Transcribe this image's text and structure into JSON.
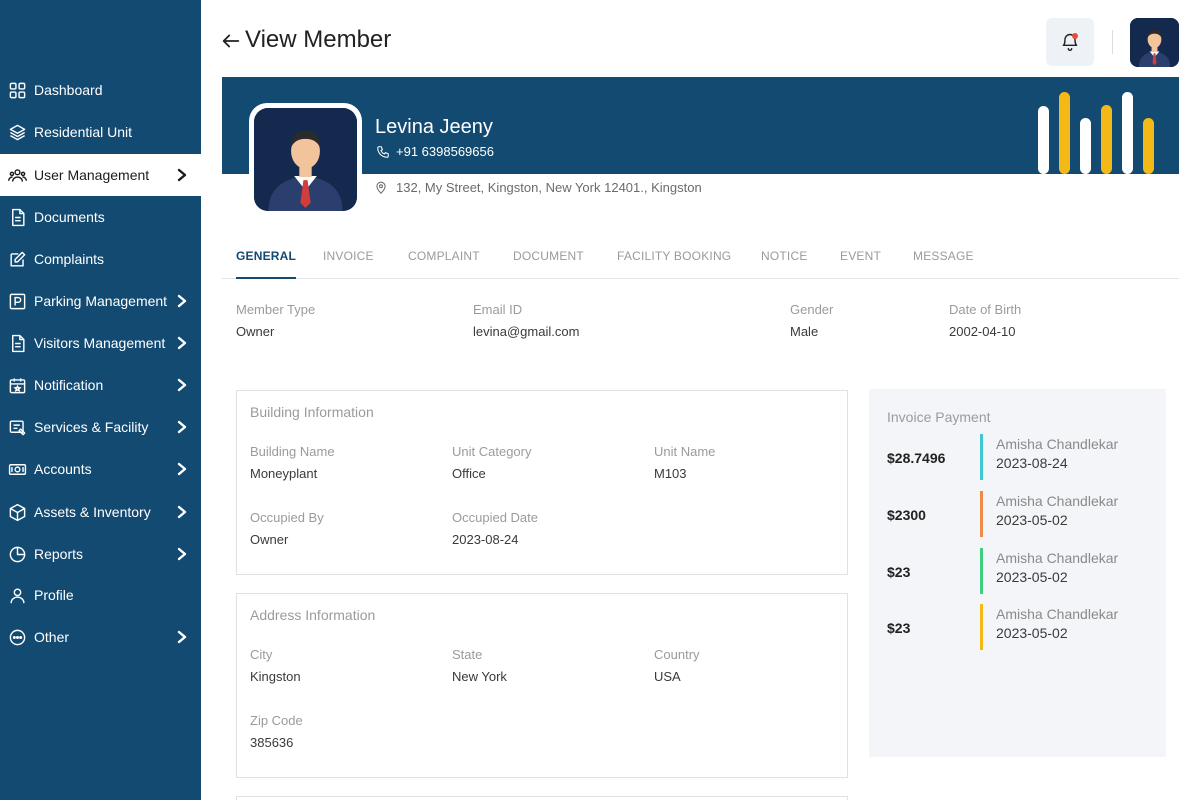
{
  "page": {
    "title": "View Member"
  },
  "sidebar": {
    "items": [
      {
        "label": "Dashboard",
        "icon": "grid-icon",
        "has_chevron": false,
        "active": false
      },
      {
        "label": "Residential Unit",
        "icon": "layers-icon",
        "has_chevron": false,
        "active": false
      },
      {
        "label": "User Management",
        "icon": "users-icon",
        "has_chevron": true,
        "active": true
      },
      {
        "label": "Documents",
        "icon": "document-icon",
        "has_chevron": false,
        "active": false
      },
      {
        "label": "Complaints",
        "icon": "edit-icon",
        "has_chevron": false,
        "active": false
      },
      {
        "label": "Parking Management",
        "icon": "parking-icon",
        "has_chevron": true,
        "active": false
      },
      {
        "label": "Visitors Management",
        "icon": "document-icon",
        "has_chevron": true,
        "active": false
      },
      {
        "label": "Notification",
        "icon": "calendar-icon",
        "has_chevron": true,
        "active": false
      },
      {
        "label": "Services & Facility",
        "icon": "service-icon",
        "has_chevron": true,
        "active": false
      },
      {
        "label": "Accounts",
        "icon": "money-icon",
        "has_chevron": true,
        "active": false
      },
      {
        "label": "Assets & Inventory",
        "icon": "box-icon",
        "has_chevron": true,
        "active": false
      },
      {
        "label": "Reports",
        "icon": "pie-chart-icon",
        "has_chevron": true,
        "active": false
      },
      {
        "label": "Profile",
        "icon": "user-icon",
        "has_chevron": false,
        "active": false
      },
      {
        "label": "Other",
        "icon": "more-icon",
        "has_chevron": true,
        "active": false
      }
    ]
  },
  "member": {
    "name": "Levina Jeeny",
    "phone": "+91  6398569656",
    "address": "132, My Street, Kingston, New York 12401., Kingston"
  },
  "tabs": [
    {
      "label": "GENERAL",
      "active": true
    },
    {
      "label": "INVOICE",
      "active": false
    },
    {
      "label": "COMPLAINT",
      "active": false
    },
    {
      "label": "DOCUMENT",
      "active": false
    },
    {
      "label": "FACILITY BOOKING",
      "active": false
    },
    {
      "label": "NOTICE",
      "active": false
    },
    {
      "label": "EVENT",
      "active": false
    },
    {
      "label": "MESSAGE",
      "active": false
    }
  ],
  "general": {
    "member_type_label": "Member Type",
    "member_type": "Owner",
    "email_label": "Email ID",
    "email": "levina@gmail.com",
    "gender_label": "Gender",
    "gender": "Male",
    "dob_label": "Date of Birth",
    "dob": "2002-04-10"
  },
  "building": {
    "title": "Building Information",
    "building_name_label": "Building Name",
    "building_name": "Moneyplant",
    "unit_category_label": "Unit Category",
    "unit_category": "Office",
    "unit_name_label": "Unit Name",
    "unit_name": "M103",
    "occupied_by_label": "Occupied By",
    "occupied_by": "Owner",
    "occupied_date_label": "Occupied Date",
    "occupied_date": "2023-08-24"
  },
  "address_info": {
    "title": "Address Information",
    "city_label": "City",
    "city": "Kingston",
    "state_label": "State",
    "state": "New York",
    "country_label": "Country",
    "country": "USA",
    "zip_label": "Zip Code",
    "zip": "385636"
  },
  "invoice": {
    "title": "Invoice Payment",
    "items": [
      {
        "amount": "$28.7496",
        "name": "Amisha Chandlekar",
        "date": "2023-08-24",
        "color": "#3cc6d6"
      },
      {
        "amount": "$2300",
        "name": "Amisha Chandlekar",
        "date": "2023-05-02",
        "color": "#f08a4b"
      },
      {
        "amount": "$23",
        "name": "Amisha Chandlekar",
        "date": "2023-05-02",
        "color": "#3fcf7f"
      },
      {
        "amount": "$23",
        "name": "Amisha Chandlekar",
        "date": "2023-05-02",
        "color": "#f4b916"
      }
    ]
  },
  "colors": {
    "primary": "#134a71",
    "accent_yellow": "#f4b916"
  }
}
